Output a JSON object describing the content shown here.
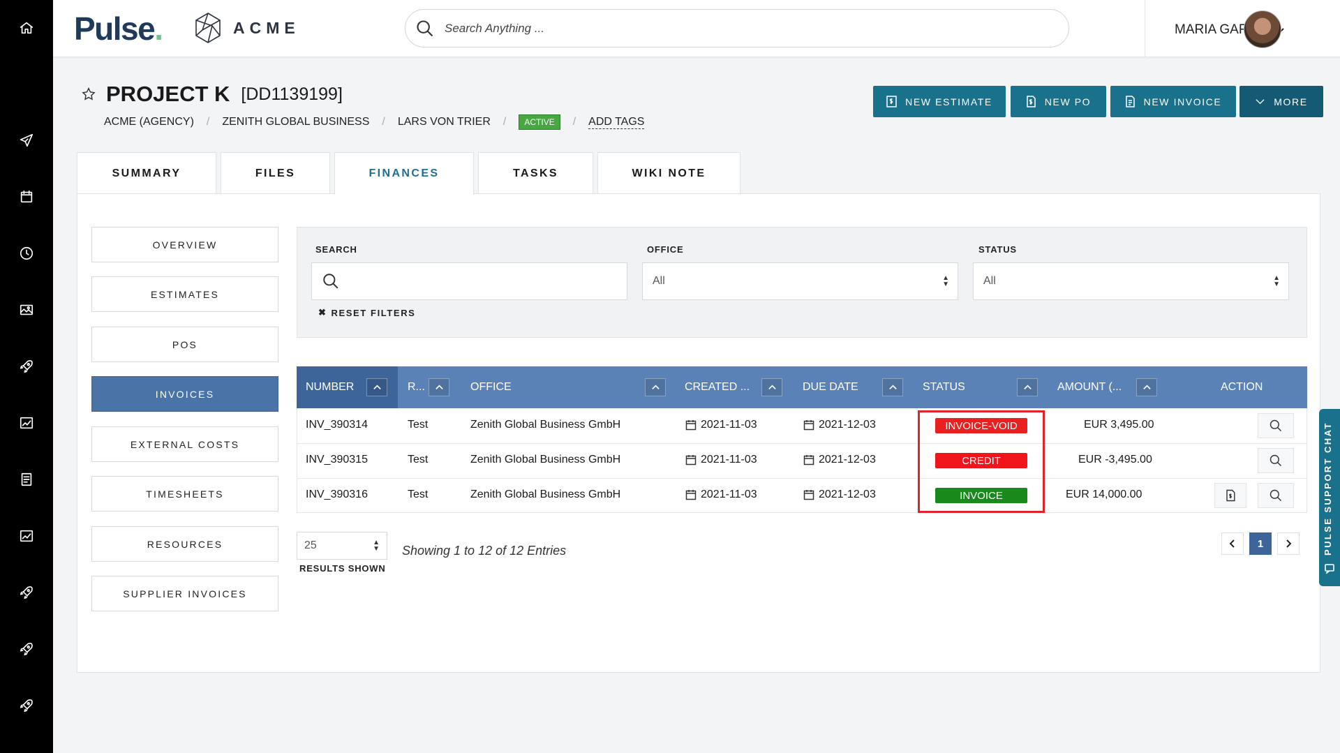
{
  "brand": {
    "app_logo": "Pulse",
    "app_logo_dot": ".",
    "client_logo": "ACME"
  },
  "search": {
    "placeholder": "Search Anything ..."
  },
  "user": {
    "name": "MARIA GARCIA"
  },
  "nav_rail": [
    "home-icon",
    "paper-plane-icon",
    "calendar-icon",
    "clock-icon",
    "image-icon",
    "rocket-icon",
    "chart-icon",
    "document-icon",
    "chart-icon",
    "rocket-icon",
    "rocket-icon",
    "rocket-icon"
  ],
  "project": {
    "name": "PROJECT K",
    "code": "[DD1139199]",
    "breadcrumb": [
      "ACME (AGENCY)",
      "ZENITH GLOBAL BUSINESS",
      "LARS VON TRIER"
    ],
    "status": "ACTIVE",
    "add_tags": "ADD TAGS"
  },
  "actions": {
    "new_estimate": "NEW ESTIMATE",
    "new_po": "NEW PO",
    "new_invoice": "NEW INVOICE",
    "more": "MORE"
  },
  "tabs": [
    "SUMMARY",
    "FILES",
    "FINANCES",
    "TASKS",
    "WIKI NOTE"
  ],
  "active_tab": "FINANCES",
  "finance_menu": [
    "OVERVIEW",
    "ESTIMATES",
    "POS",
    "INVOICES",
    "EXTERNAL COSTS",
    "TIMESHEETS",
    "RESOURCES",
    "SUPPLIER INVOICES"
  ],
  "active_menu": "INVOICES",
  "filters": {
    "search_label": "SEARCH",
    "search_value": "",
    "office_label": "OFFICE",
    "office_value": "All",
    "status_label": "STATUS",
    "status_value": "All",
    "reset": "RESET FILTERS"
  },
  "table": {
    "columns": [
      "NUMBER",
      "R...",
      "OFFICE",
      "CREATED ...",
      "DUE DATE",
      "STATUS",
      "AMOUNT (...",
      "ACTION"
    ],
    "rows": [
      {
        "number": "INV_390314",
        "ref": "Test",
        "office": "Zenith Global Business GmbH",
        "created": "2021-11-03",
        "due": "2021-12-03",
        "status": "INVOICE-VOID",
        "amount": "EUR 3,495.00"
      },
      {
        "number": "INV_390315",
        "ref": "Test",
        "office": "Zenith Global Business GmbH",
        "created": "2021-11-03",
        "due": "2021-12-03",
        "status": "CREDIT",
        "amount": "EUR -3,495.00"
      },
      {
        "number": "INV_390316",
        "ref": "Test",
        "office": "Zenith Global Business GmbH",
        "created": "2021-11-03",
        "due": "2021-12-03",
        "status": "INVOICE",
        "amount": "EUR 14,000.00"
      }
    ]
  },
  "status_colors": {
    "INVOICE-VOID": "#e8201f",
    "CREDIT": "#f0151a",
    "INVOICE": "#188a1c"
  },
  "pagination": {
    "page_size": "25",
    "results_label": "RESULTS SHOWN",
    "showing": "Showing 1 to 12 of 12 Entries",
    "current_page": "1"
  },
  "support_chat": "PULSE SUPPORT CHAT",
  "colors": {
    "accent": "#1a718c",
    "table_header": "#5a82b6",
    "active_menu": "#4a73a8",
    "highlight": "#e0232b"
  }
}
